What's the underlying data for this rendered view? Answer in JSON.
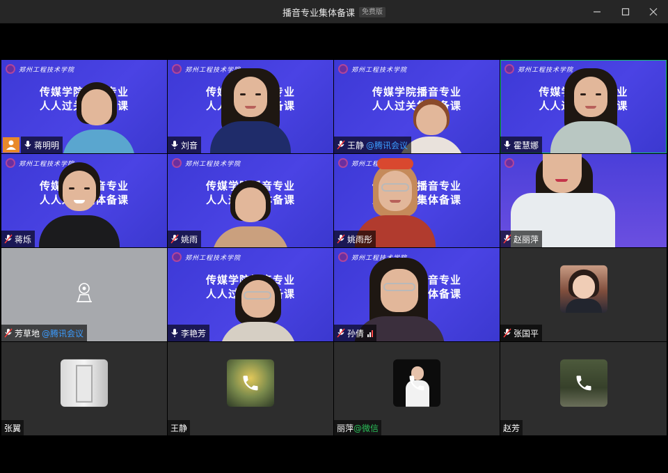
{
  "window": {
    "title": "播音专业集体备课",
    "edition_badge": "免费版"
  },
  "slide": {
    "school_name": "郑州工程技术学院",
    "line1": "传媒学院播音专业",
    "line2": "人人过关集体备课"
  },
  "colors": {
    "slide_blue": "#4540dd",
    "active_speaker": "#18c07a",
    "host_badge": "#e8892a",
    "tencent_link": "#3b9cff",
    "wechat_link": "#2bc15a"
  },
  "participants": [
    {
      "name": "蒋明明",
      "source": "",
      "host": true,
      "mic": "on",
      "video": "slide"
    },
    {
      "name": "刘音",
      "source": "",
      "host": false,
      "mic": "on",
      "video": "slide"
    },
    {
      "name": "王静",
      "source": "@腾讯会议",
      "host": false,
      "mic": "muted",
      "video": "slide"
    },
    {
      "name": "霍慧娜",
      "source": "",
      "host": false,
      "mic": "on",
      "video": "slide",
      "active": true
    },
    {
      "name": "蒋烁",
      "source": "",
      "host": false,
      "mic": "muted",
      "video": "slide"
    },
    {
      "name": "姚雨",
      "source": "",
      "host": false,
      "mic": "muted",
      "video": "slide"
    },
    {
      "name": "姚雨彤",
      "source": "",
      "host": false,
      "mic": "muted",
      "video": "slide"
    },
    {
      "name": "赵丽萍",
      "source": "",
      "host": false,
      "mic": "muted",
      "video": "camera"
    },
    {
      "name": "芳草地",
      "source": "@腾讯会议",
      "host": false,
      "mic": "muted",
      "video": "off"
    },
    {
      "name": "李艳芳",
      "source": "",
      "host": false,
      "mic": "on",
      "video": "slide"
    },
    {
      "name": "孙倩",
      "source": "",
      "host": false,
      "mic": "muted",
      "video": "slide",
      "signal": true
    },
    {
      "name": "张国平",
      "source": "",
      "host": false,
      "mic": "muted",
      "video": "avatar"
    },
    {
      "name": "张翼",
      "source": "",
      "host": false,
      "mic": "none",
      "video": "avatar"
    },
    {
      "name": "王静",
      "source": "",
      "host": false,
      "mic": "none",
      "video": "phone"
    },
    {
      "name": "丽萍",
      "source": "@微信",
      "host": false,
      "mic": "none",
      "video": "phone"
    },
    {
      "name": "赵芳",
      "source": "",
      "host": false,
      "mic": "none",
      "video": "phone"
    }
  ]
}
